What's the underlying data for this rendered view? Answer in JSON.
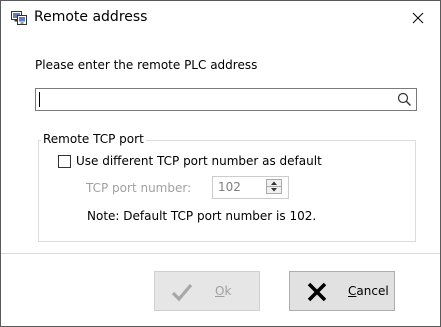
{
  "window": {
    "title": "Remote address",
    "close_glyph": "✕"
  },
  "prompt": "Please enter the remote PLC address",
  "address_input": {
    "value": "",
    "placeholder": ""
  },
  "tcp_group": {
    "legend": "Remote TCP port",
    "checkbox_label": "Use different TCP port number as default",
    "checkbox_checked": false,
    "port_label": "TCP port number:",
    "port_value": "102",
    "port_enabled": false,
    "note": "Note: Default TCP port number is 102."
  },
  "buttons": {
    "ok": {
      "mnemonic": "O",
      "rest": "k",
      "enabled": false
    },
    "cancel": {
      "mnemonic": "C",
      "rest": "ancel",
      "enabled": true
    }
  },
  "icons": {
    "title": "network-computers-icon",
    "search": "search-icon",
    "ok": "checkmark-icon",
    "cancel": "x-icon"
  },
  "colors": {
    "disabled_text": "#a0a0a0",
    "button_face": "#e1e1e1",
    "border": "#7a7a7a"
  }
}
